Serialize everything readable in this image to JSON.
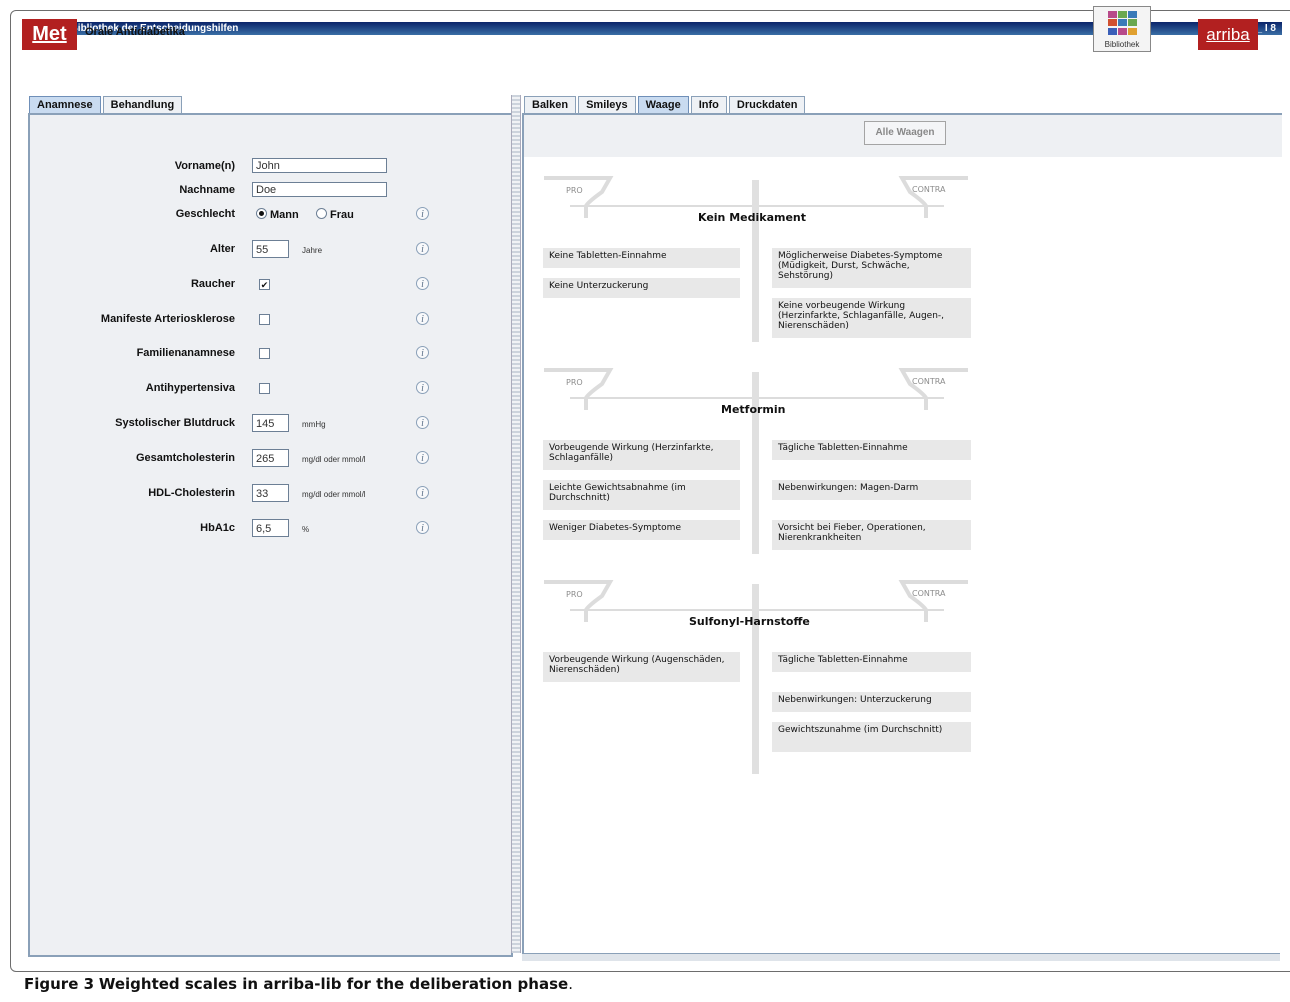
{
  "window": {
    "title": "arriba Bibliothek der Entscheidungshilfen",
    "controls": "_ I 8"
  },
  "header": {
    "module_logo": "Met",
    "module_title": "Orale Antidiabetika",
    "library_label": "Bibliothek",
    "brand": "arriba"
  },
  "left_tabs": [
    {
      "label": "Anamnese"
    },
    {
      "label": "Behandlung"
    }
  ],
  "form": {
    "first_name_label": "Vorname(n)",
    "first_name_value": "John",
    "last_name_label": "Nachname",
    "last_name_value": "Doe",
    "gender_label": "Geschlecht",
    "gender_male": "Mann",
    "gender_female": "Frau",
    "age_label": "Alter",
    "age_value": "55",
    "age_unit": "Jahre",
    "smoker_label": "Raucher",
    "arterio_label": "Manifeste Arteriosklerose",
    "family_label": "Familienanamnese",
    "antihyp_label": "Antihypertensiva",
    "sbp_label": "Systolischer Blutdruck",
    "sbp_value": "145",
    "sbp_unit": "mmHg",
    "chol_label": "Gesamtcholesterin",
    "chol_value": "265",
    "chol_unit": "mg/dl oder mmol/l",
    "hdl_label": "HDL-Cholesterin",
    "hdl_value": "33",
    "hdl_unit": "mg/dl oder mmol/l",
    "hba1c_label": "HbA1c",
    "hba1c_value": "6,5",
    "hba1c_unit": "%",
    "info_glyph": "i",
    "check_glyph": "✔"
  },
  "right_tabs": [
    {
      "label": "Balken"
    },
    {
      "label": "Smileys"
    },
    {
      "label": "Waage"
    },
    {
      "label": "Info"
    },
    {
      "label": "Druckdaten"
    }
  ],
  "toolbar": {
    "all_scales_label": "Alle Waagen"
  },
  "scales": [
    {
      "title": "Kein Medikament",
      "pro_label": "PRO",
      "contra_label": "CONTRA",
      "pro": [
        "Keine Tabletten-Einnahme",
        "Keine Unterzuckerung"
      ],
      "contra": [
        "Möglicherweise Diabetes-Symptome (Müdigkeit, Durst, Schwäche, Sehstörung)",
        "Keine vorbeugende Wirkung (Herzinfarkte, Schlaganfälle, Augen-, Nierenschäden)"
      ]
    },
    {
      "title": "Metformin",
      "pro_label": "PRO",
      "contra_label": "CONTRA",
      "pro": [
        "Vorbeugende Wirkung (Herzinfarkte, Schlaganfälle)",
        "Leichte Gewichtsabnahme (im Durchschnitt)",
        "Weniger Diabetes-Symptome"
      ],
      "contra": [
        "Tägliche Tabletten-Einnahme",
        "Nebenwirkungen: Magen-Darm",
        "Vorsicht bei Fieber, Operationen, Nierenkrankheiten"
      ]
    },
    {
      "title": "Sulfonyl-Harnstoffe",
      "pro_label": "PRO",
      "contra_label": "CONTRA",
      "pro": [
        "Vorbeugende Wirkung (Augenschäden, Nierenschäden)"
      ],
      "contra": [
        "Tägliche Tabletten-Einnahme",
        "Nebenwirkungen: Unterzuckerung",
        "Gewichtszunahme (im Durchschnitt)"
      ]
    }
  ],
  "caption": {
    "label": "Figure 3",
    "text": "Weighted scales in arriba-lib for the deliberation phase",
    "period": "."
  }
}
